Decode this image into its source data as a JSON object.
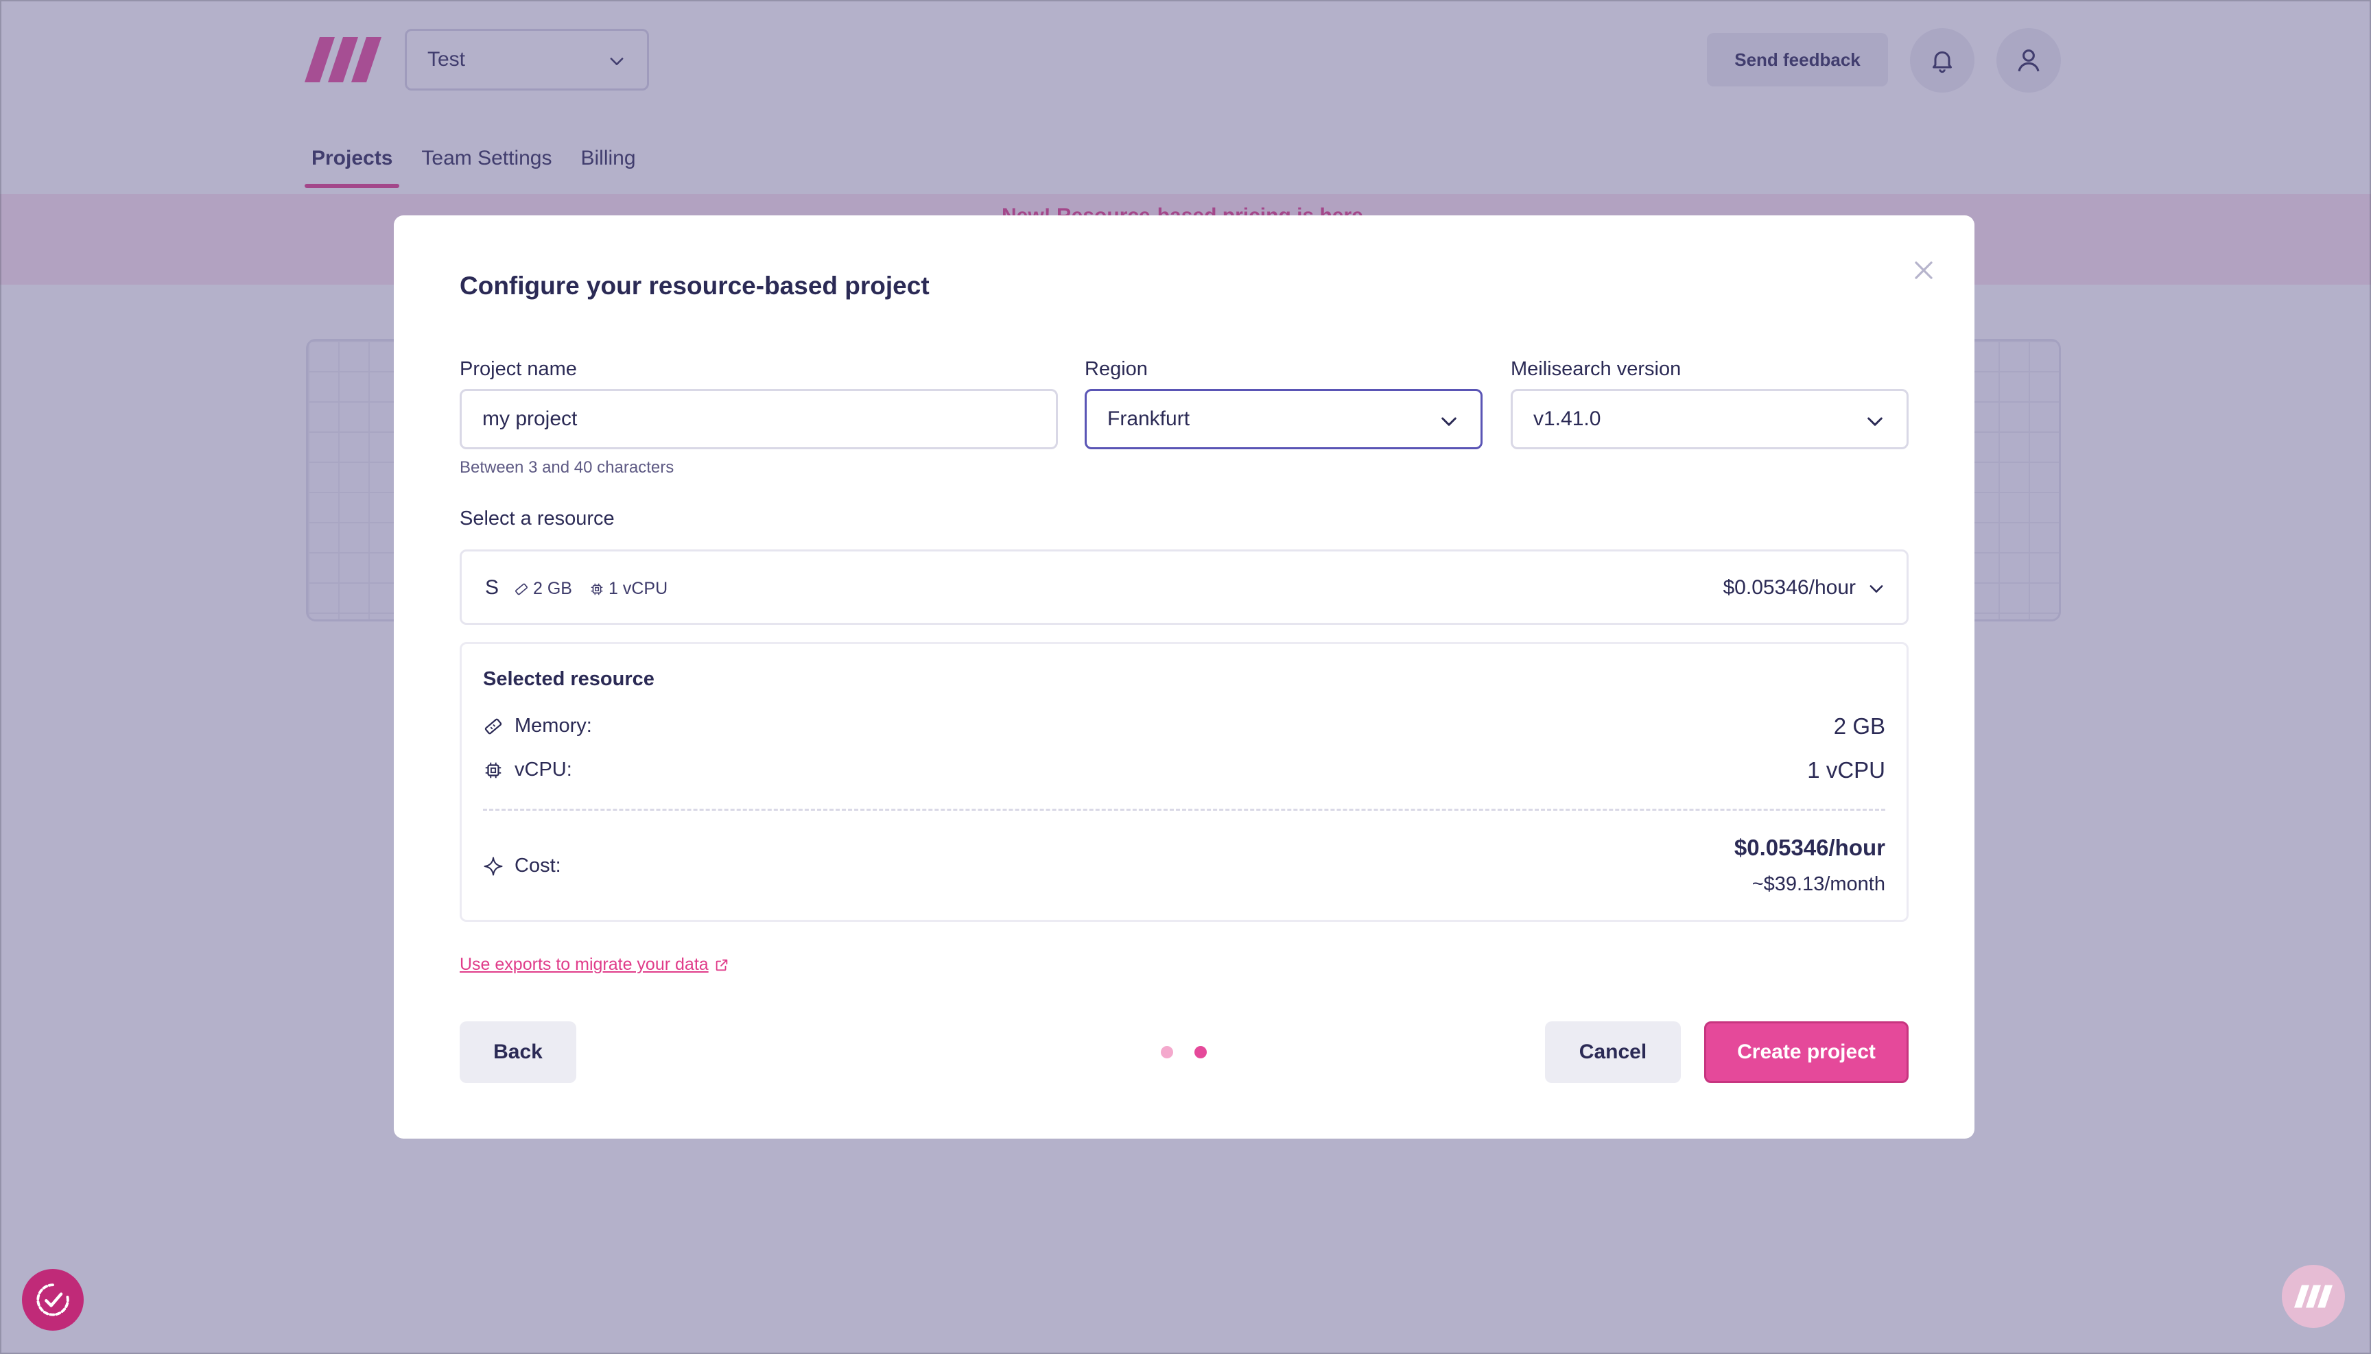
{
  "header": {
    "team_selected": "Test",
    "send_feedback_label": "Send feedback",
    "tabs": [
      {
        "label": "Projects",
        "active": true
      },
      {
        "label": "Team Settings",
        "active": false
      },
      {
        "label": "Billing",
        "active": false
      }
    ],
    "banner_text": "New! Resource-based pricing is here"
  },
  "modal": {
    "title": "Configure your resource-based project",
    "project_name": {
      "label": "Project name",
      "value": "my project",
      "hint": "Between 3 and 40 characters"
    },
    "region": {
      "label": "Region",
      "value": "Frankfurt"
    },
    "version": {
      "label": "Meilisearch version",
      "value": "v1.41.0"
    },
    "resource_section_label": "Select a resource",
    "resource": {
      "size": "S",
      "memory": "2 GB",
      "vcpu": "1 vCPU",
      "price": "$0.05346/hour"
    },
    "selected": {
      "title": "Selected resource",
      "memory_label": "Memory:",
      "memory_value": "2 GB",
      "vcpu_label": "vCPU:",
      "vcpu_value": "1 vCPU",
      "cost_label": "Cost:",
      "cost_hourly": "$0.05346/hour",
      "cost_monthly": "~$39.13/month"
    },
    "migrate_link": "Use exports to migrate your data",
    "back_label": "Back",
    "cancel_label": "Cancel",
    "create_label": "Create project",
    "steps": {
      "total": 2,
      "current": 2
    }
  },
  "colors": {
    "brand": "#e5499a",
    "text": "#2b2a55",
    "overlay": "#5c568c",
    "focus_border": "#5a55b5"
  }
}
